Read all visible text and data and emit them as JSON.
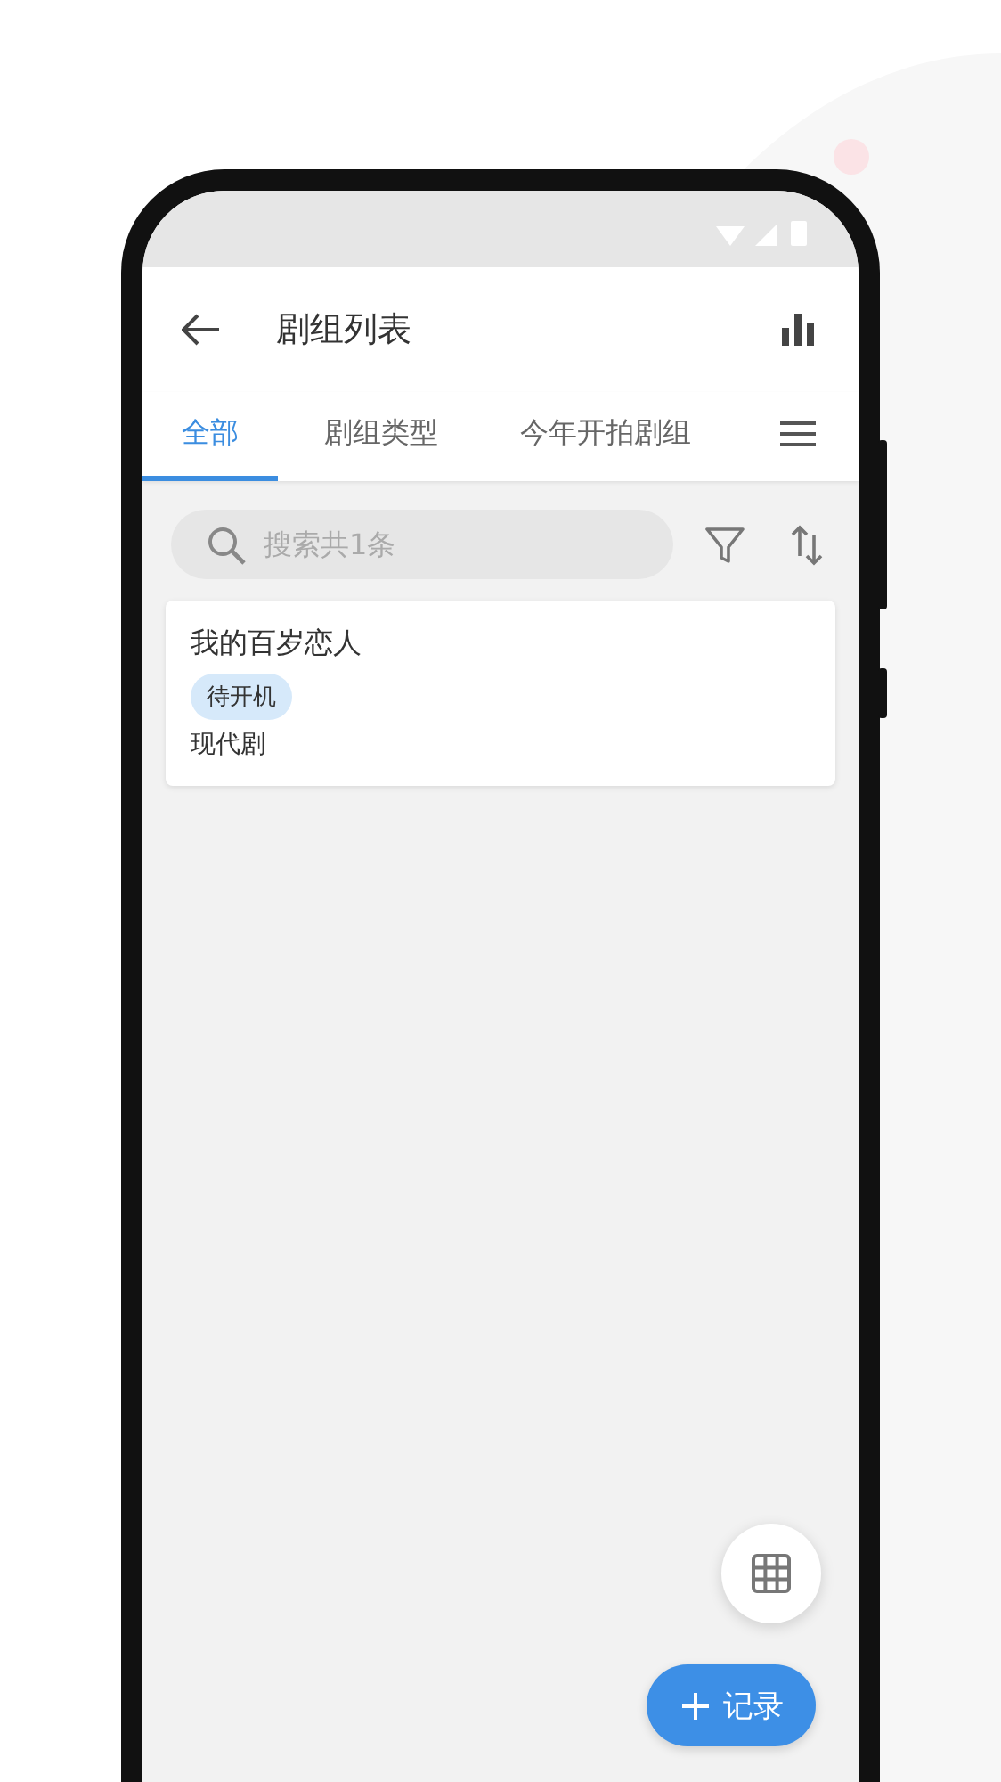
{
  "app_bar": {
    "title": "剧组列表"
  },
  "tabs": [
    {
      "label": "全部",
      "selected": true
    },
    {
      "label": "剧组类型",
      "selected": false
    },
    {
      "label": "今年开拍剧组",
      "selected": false
    }
  ],
  "search": {
    "placeholder": "搜索共1条"
  },
  "items": [
    {
      "title": "我的百岁恋人",
      "status": "待开机",
      "genre": "现代剧"
    }
  ],
  "record_button": {
    "label": "记录"
  }
}
